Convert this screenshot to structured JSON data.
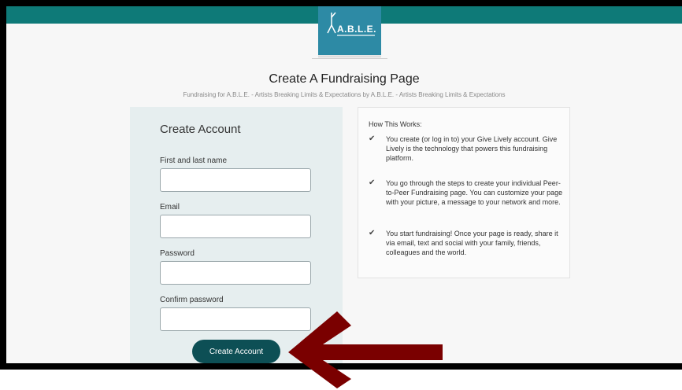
{
  "logo": {
    "text": "A.B.L.E."
  },
  "page": {
    "title": "Create A Fundraising Page",
    "subtitle": "Fundraising for A.B.L.E. - Artists Breaking Limits & Expectations by A.B.L.E. - Artists Breaking Limits & Expectations"
  },
  "form": {
    "heading": "Create Account",
    "name_label": "First and last name",
    "email_label": "Email",
    "password_label": "Password",
    "confirm_label": "Confirm password",
    "submit_label": "Create Account"
  },
  "how": {
    "title": "How This Works:",
    "items": [
      {
        "text": "You create (or log in to) your Give Lively account. Give Lively is the technology that powers this fundraising platform."
      },
      {
        "text": "You go through the steps to create your individual Peer-to-Peer Fundraising page. You can customize your page with your picture, a message to your network and more."
      },
      {
        "text": "You start fundraising! Once your page is ready, share it via email, text and social with your family, friends, colleagues and the world."
      }
    ]
  },
  "icons": {
    "check": "check-icon",
    "arrow": "arrow-left-icon"
  },
  "colors": {
    "topbar": "#0e7a78",
    "button": "#0d4f55",
    "arrow": "#7a0000",
    "panel": "#e6eeef"
  }
}
